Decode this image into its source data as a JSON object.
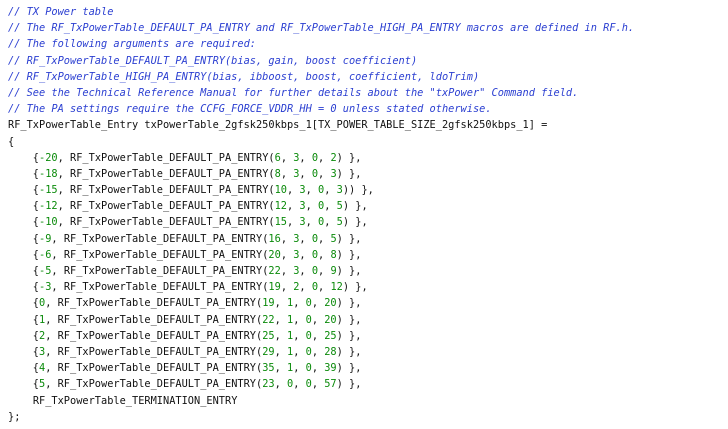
{
  "comments": [
    "// TX Power table",
    "// The RF_TxPowerTable_DEFAULT_PA_ENTRY and RF_TxPowerTable_HIGH_PA_ENTRY macros are defined in RF.h.",
    "// The following arguments are required:",
    "// RF_TxPowerTable_DEFAULT_PA_ENTRY(bias, gain, boost coefficient)",
    "// RF_TxPowerTable_HIGH_PA_ENTRY(bias, ibboost, boost, coefficient, ldoTrim)",
    "// See the Technical Reference Manual for further details about the \"txPower\" Command field.",
    "// The PA settings require the CCFG_FORCE_VDDR_HH = 0 unless stated otherwise."
  ],
  "declaration": "RF_TxPowerTable_Entry txPowerTable_2gfsk250kbps_1[TX_POWER_TABLE_SIZE_2gfsk250kbps_1] =",
  "open_brace": "{",
  "macro_name": "RF_TxPowerTable_DEFAULT_PA_ENTRY",
  "entries": [
    {
      "dbm": "-20",
      "args": [
        "6",
        "3",
        "0",
        "2"
      ],
      "sep": " },"
    },
    {
      "dbm": "-18",
      "args": [
        "8",
        "3",
        "0",
        "3"
      ],
      "sep": " },"
    },
    {
      "dbm": "-15",
      "args": [
        "10",
        "3",
        "0",
        "3"
      ],
      "sep": ") },"
    },
    {
      "dbm": "-12",
      "args": [
        "12",
        "3",
        "0",
        "5"
      ],
      "sep": " },"
    },
    {
      "dbm": "-10",
      "args": [
        "15",
        "3",
        "0",
        "5"
      ],
      "sep": " },"
    },
    {
      "dbm": "-9",
      "args": [
        "16",
        "3",
        "0",
        "5"
      ],
      "sep": " },"
    },
    {
      "dbm": "-6",
      "args": [
        "20",
        "3",
        "0",
        "8"
      ],
      "sep": " },"
    },
    {
      "dbm": "-5",
      "args": [
        "22",
        "3",
        "0",
        "9"
      ],
      "sep": " },"
    },
    {
      "dbm": "-3",
      "args": [
        "19",
        "2",
        "0",
        "12"
      ],
      "sep": " },"
    },
    {
      "dbm": "0",
      "args": [
        "19",
        "1",
        "0",
        "20"
      ],
      "sep": " },"
    },
    {
      "dbm": "1",
      "args": [
        "22",
        "1",
        "0",
        "20"
      ],
      "sep": " },"
    },
    {
      "dbm": "2",
      "args": [
        "25",
        "1",
        "0",
        "25"
      ],
      "sep": " },"
    },
    {
      "dbm": "3",
      "args": [
        "29",
        "1",
        "0",
        "28"
      ],
      "sep": " },"
    },
    {
      "dbm": "4",
      "args": [
        "35",
        "1",
        "0",
        "39"
      ],
      "sep": " },"
    },
    {
      "dbm": "5",
      "args": [
        "23",
        "0",
        "0",
        "57"
      ],
      "sep": " },"
    }
  ],
  "termination": "RF_TxPowerTable_TERMINATION_ENTRY",
  "close_brace": "};",
  "colors": {
    "comment": "#2b3fd1",
    "number": "#0a8a0a",
    "text": "#111111",
    "background": "#ffffff"
  }
}
